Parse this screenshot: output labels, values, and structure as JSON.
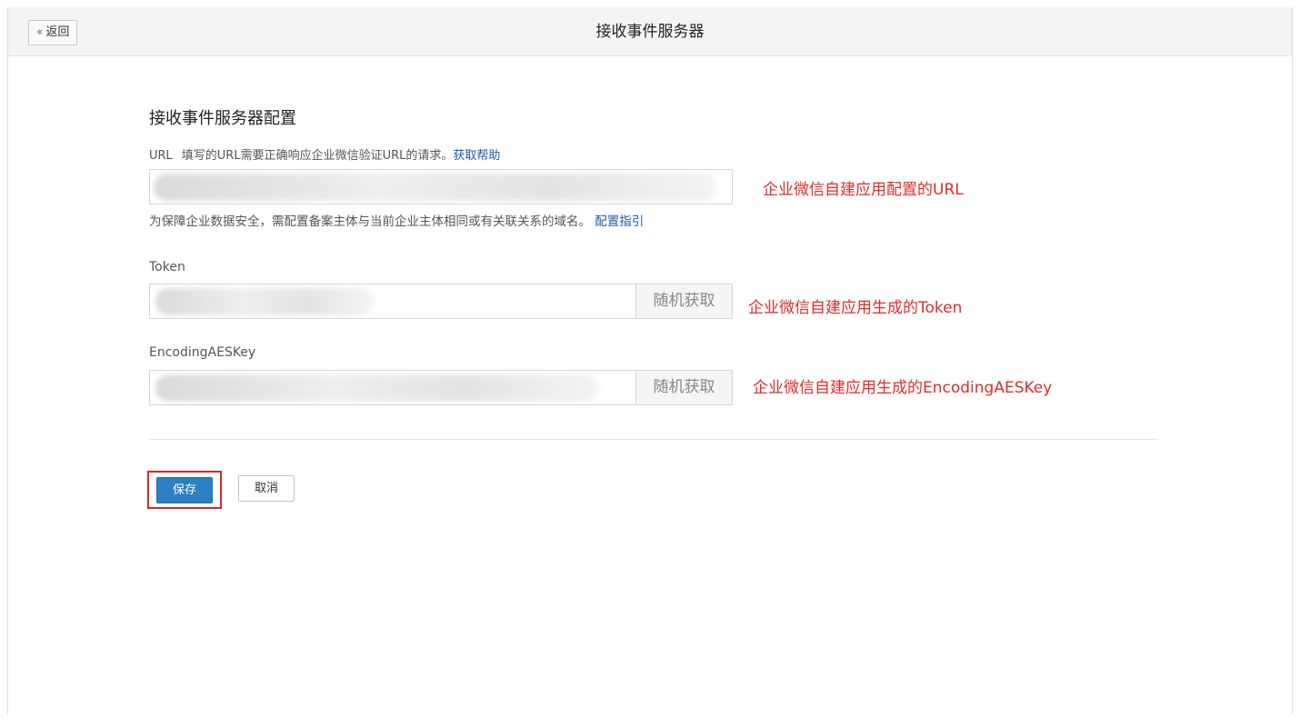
{
  "header": {
    "back_label": "返回",
    "title": "接收事件服务器"
  },
  "section": {
    "title": "接收事件服务器配置"
  },
  "url_field": {
    "label": "URL",
    "description": "填写的URL需要正确响应企业微信验证URL的请求。",
    "help_link": "获取帮助",
    "value": "",
    "annotation": "企业微信自建应用配置的URL",
    "hint": "为保障企业数据安全，需配置备案主体与当前企业主体相同或有关联关系的域名。",
    "hint_link": "配置指引"
  },
  "token_field": {
    "label": "Token",
    "value": "",
    "random_button": "随机获取",
    "annotation": "企业微信自建应用生成的Token"
  },
  "aes_field": {
    "label": "EncodingAESKey",
    "value": "",
    "random_button": "随机获取",
    "annotation": "企业微信自建应用生成的EncodingAESKey"
  },
  "actions": {
    "save_label": "保存",
    "cancel_label": "取消"
  },
  "colors": {
    "primary_button": "#2d7fc3",
    "annotation_red": "#e02b2b",
    "link_blue": "#1d5cb0"
  }
}
